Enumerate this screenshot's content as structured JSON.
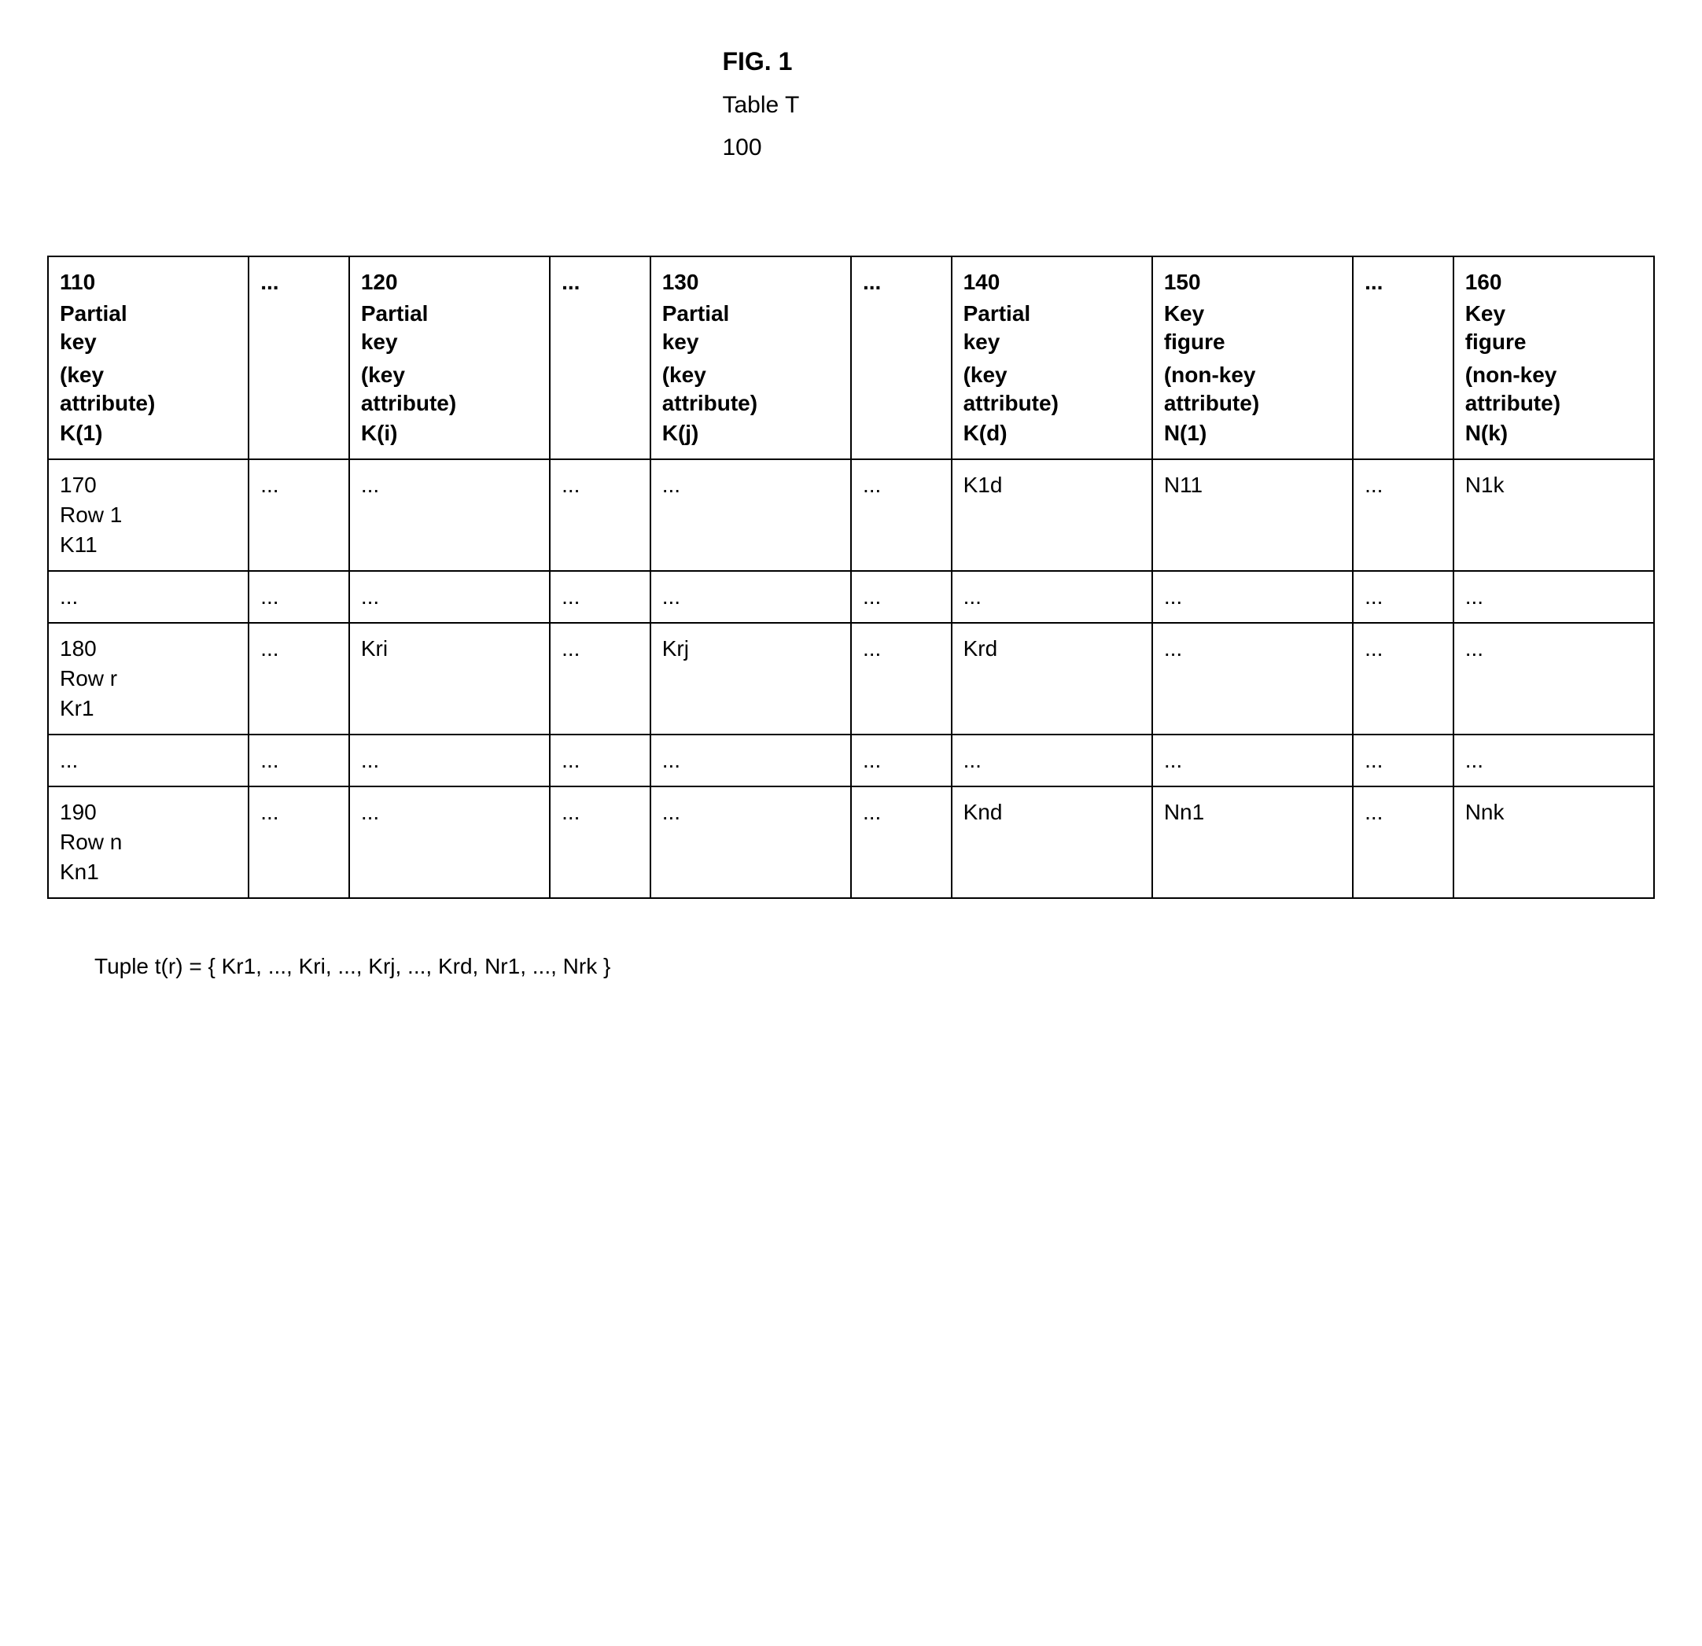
{
  "header": {
    "fig_title": "FIG. 1",
    "table_title": "Table T",
    "table_num": "100"
  },
  "columns": [
    {
      "num": "110",
      "line1": "Partial",
      "line2": "key",
      "attr1": "(key",
      "attr2": "attribute)",
      "sym": "K(1)"
    },
    {
      "ellipsis": "..."
    },
    {
      "num": "120",
      "line1": "Partial",
      "line2": "key",
      "attr1": "(key",
      "attr2": "attribute)",
      "sym": "K(i)"
    },
    {
      "ellipsis": "..."
    },
    {
      "num": "130",
      "line1": "Partial",
      "line2": "key",
      "attr1": "(key",
      "attr2": "attribute)",
      "sym": "K(j)"
    },
    {
      "ellipsis": "..."
    },
    {
      "num": "140",
      "line1": "Partial",
      "line2": "key",
      "attr1": "(key",
      "attr2": "attribute)",
      "sym": "K(d)"
    },
    {
      "num": "150",
      "line1": "Key",
      "line2": "figure",
      "attr1": "(non-key",
      "attr2": "attribute)",
      "sym": "N(1)"
    },
    {
      "ellipsis": "..."
    },
    {
      "num": "160",
      "line1": "Key",
      "line2": "figure",
      "attr1": "(non-key",
      "attr2": "attribute)",
      "sym": "N(k)"
    }
  ],
  "rows": [
    {
      "cells": [
        {
          "num": "170",
          "lbl": "Row 1",
          "val": "K11"
        },
        {
          "val": "..."
        },
        {
          "val": "..."
        },
        {
          "val": "..."
        },
        {
          "val": "..."
        },
        {
          "val": "..."
        },
        {
          "val": "K1d"
        },
        {
          "val": "N11"
        },
        {
          "val": "..."
        },
        {
          "val": "N1k"
        }
      ]
    },
    {
      "cells": [
        {
          "val": "..."
        },
        {
          "val": "..."
        },
        {
          "val": "..."
        },
        {
          "val": "..."
        },
        {
          "val": "..."
        },
        {
          "val": "..."
        },
        {
          "val": "..."
        },
        {
          "val": "..."
        },
        {
          "val": "..."
        },
        {
          "val": "..."
        }
      ]
    },
    {
      "cells": [
        {
          "num": "180",
          "lbl": "Row r",
          "val": "Kr1"
        },
        {
          "val": "..."
        },
        {
          "val": "Kri"
        },
        {
          "val": "..."
        },
        {
          "val": "Krj"
        },
        {
          "val": "..."
        },
        {
          "val": "Krd"
        },
        {
          "val": "..."
        },
        {
          "val": "..."
        },
        {
          "val": "..."
        }
      ]
    },
    {
      "cells": [
        {
          "val": "..."
        },
        {
          "val": "..."
        },
        {
          "val": "..."
        },
        {
          "val": "..."
        },
        {
          "val": "..."
        },
        {
          "val": "..."
        },
        {
          "val": "..."
        },
        {
          "val": "..."
        },
        {
          "val": "..."
        },
        {
          "val": "..."
        }
      ]
    },
    {
      "cells": [
        {
          "num": "190",
          "lbl": "Row n",
          "val": "Kn1"
        },
        {
          "val": "..."
        },
        {
          "val": "..."
        },
        {
          "val": "..."
        },
        {
          "val": "..."
        },
        {
          "val": "..."
        },
        {
          "val": "Knd"
        },
        {
          "val": "Nn1"
        },
        {
          "val": "..."
        },
        {
          "val": "Nnk"
        }
      ]
    }
  ],
  "footer": "Tuple t(r) = { Kr1, ..., Kri, ..., Krj, ..., Krd, Nr1, ..., Nrk }"
}
